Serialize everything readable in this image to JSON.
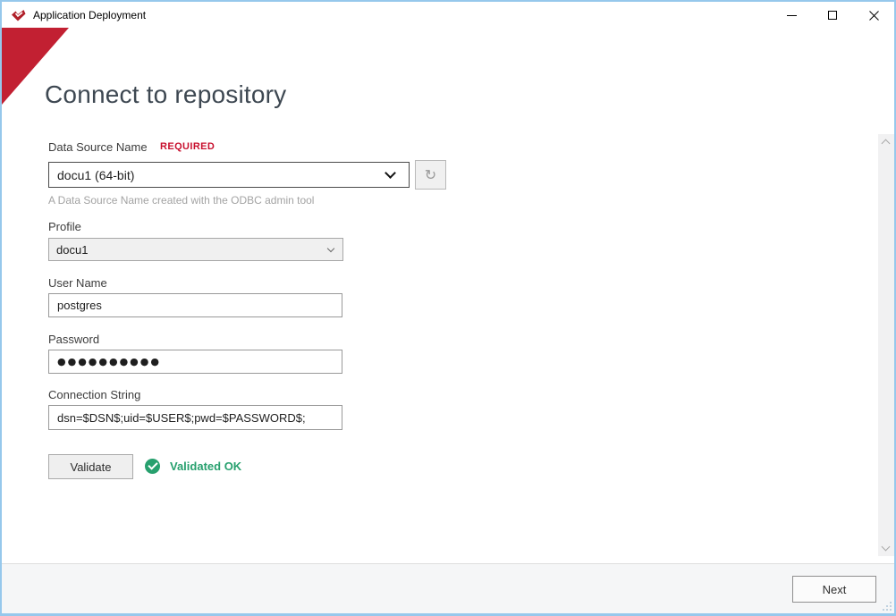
{
  "window": {
    "title": "Application Deployment",
    "icons": {
      "app_logo": "red-check-brand-logo",
      "minimize": "minimize",
      "maximize": "maximize",
      "close": "close"
    }
  },
  "page": {
    "heading": "Connect to repository"
  },
  "form": {
    "dsn": {
      "label": "Data Source Name",
      "required_badge": "REQUIRED",
      "value": "docu1 (64-bit)",
      "refresh_icon": "↻",
      "help": "A Data Source Name created with the ODBC admin tool"
    },
    "profile": {
      "label": "Profile",
      "value": "docu1"
    },
    "username": {
      "label": "User Name",
      "value": "postgres"
    },
    "password": {
      "label": "Password",
      "value": "●●●●●●●●●●"
    },
    "connection_string": {
      "label": "Connection String",
      "value": "dsn=$DSN$;uid=$USER$;pwd=$PASSWORD$;"
    },
    "validate_button": "Validate",
    "validation_status": "Validated OK"
  },
  "footer": {
    "next_button": "Next"
  },
  "colors": {
    "brand_red": "#c22032",
    "required_red": "#c8102e",
    "success_green": "#27a06e",
    "heading_color": "#3e4852",
    "window_border": "#96c8ec"
  }
}
